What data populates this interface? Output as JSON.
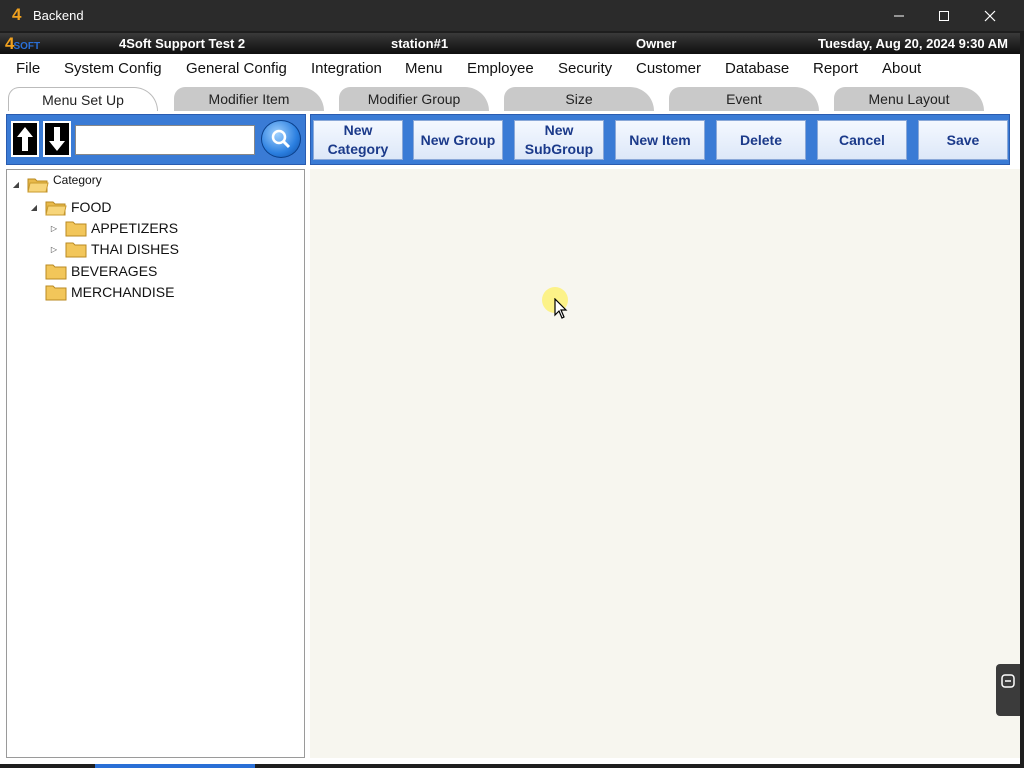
{
  "window": {
    "title": "Backend",
    "logo_char": "4",
    "controls": {
      "minimize": "minimize",
      "maximize": "maximize",
      "close": "close"
    }
  },
  "infobar": {
    "brand": "4",
    "brand_suffix": "SOFT",
    "company": "4Soft Support Test 2",
    "station": "station#1",
    "role": "Owner",
    "datetime": "Tuesday, Aug 20, 2024 9:30 AM"
  },
  "menu": {
    "items": [
      "File",
      "System Config",
      "General Config",
      "Integration",
      "Menu",
      "Employee",
      "Security",
      "Customer",
      "Database",
      "Report",
      "About"
    ]
  },
  "tabs": {
    "items": [
      "Menu Set Up",
      "Modifier Item",
      "Modifier Group",
      "Size",
      "Event",
      "Menu Layout"
    ],
    "active": "Menu Set Up"
  },
  "left_toolbar": {
    "search_value": "",
    "up_icon": "arrow-up-icon",
    "down_icon": "arrow-down-icon",
    "search_icon": "search-icon"
  },
  "actions": {
    "new_category": "New\nCategory",
    "new_group": "New Group",
    "new_subgroup": "New\nSubGroup",
    "new_item": "New Item",
    "delete": "Delete",
    "cancel": "Cancel",
    "save": "Save"
  },
  "tree": {
    "root": "Category",
    "food": "FOOD",
    "appetizers": "APPETIZERS",
    "thai_dishes": "THAI DISHES",
    "beverages": "BEVERAGES",
    "merchandise": "MERCHANDISE"
  },
  "colors": {
    "toolbar_blue": "#3a7bd5",
    "button_text": "#1b3a8a",
    "content_bg": "#f7f6ef",
    "tab_inactive": "#c9c9c9",
    "logo_orange": "#f0a11f"
  }
}
